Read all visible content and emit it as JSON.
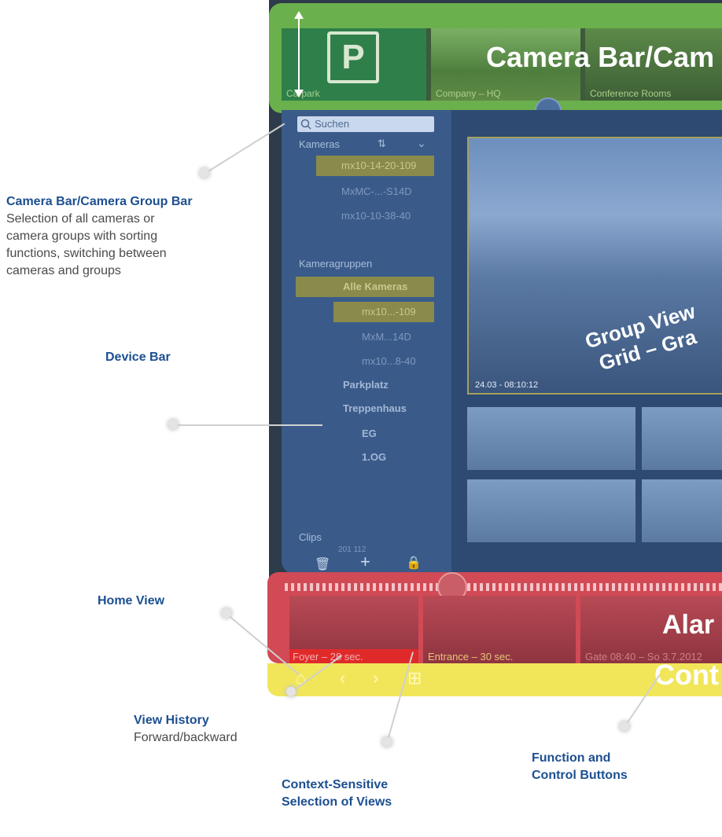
{
  "annotations": {
    "camera_bar": {
      "title": "Camera Bar/Camera Group Bar",
      "desc1": "Selection of all cameras or",
      "desc2": "camera groups with sorting",
      "desc3": "functions, switching between",
      "desc4": "cameras and groups"
    },
    "device_bar": {
      "title": "Device Bar"
    },
    "home_view": {
      "title": "Home View"
    },
    "view_history": {
      "title": "View History",
      "desc": "Forward/backward"
    },
    "context_views": {
      "title1": "Context-Sensitive",
      "title2": "Selection of Views"
    },
    "function_buttons": {
      "title1": "Function and",
      "title2": "Control Buttons"
    }
  },
  "camera_bar": {
    "overlay_title": "Camera Bar/Cam",
    "thumbs": [
      {
        "label": "Carpark",
        "icon": "P"
      },
      {
        "label": "Company – HQ"
      },
      {
        "label": "Conference Rooms"
      }
    ]
  },
  "device_bar": {
    "search_placeholder": "Suchen",
    "cameras_header": "Kameras",
    "cameras": [
      "mx10-14-20-109",
      "MxMC-...-S14D",
      "mx10-10-38-40"
    ],
    "groups_header": "Kameragruppen",
    "groups": {
      "all": "Alle Kameras",
      "all_children": [
        "mx10...-109",
        "MxM...14D",
        "mx10...8-40"
      ],
      "parking": "Parkplatz",
      "stairs": "Treppenhaus",
      "eg": "EG",
      "og": "1.OG"
    },
    "clips_header": "Clips",
    "clips_row": "201 112"
  },
  "view_area": {
    "timestamp": "24.03 - 08:10:12",
    "overlay_line1": "Group View",
    "overlay_line2": "Grid – Gra"
  },
  "alarm_bar": {
    "overlay_title": "Alar",
    "labels": [
      "Foyer – 28 sec.",
      "Entrance – 30 sec.",
      "Gate 08:40 – So 3.7.2012"
    ]
  },
  "control_bar": {
    "overlay_title": "Cont",
    "icons": [
      "home-icon",
      "back-icon",
      "forward-icon",
      "views-icon"
    ]
  },
  "colors": {
    "annotation_title": "#1c4f91",
    "camera_bar": "#6ab04c",
    "device_bar": "#3a5b8a",
    "alarm_bar": "#d14a55",
    "control_bar": "#f1e65a"
  }
}
